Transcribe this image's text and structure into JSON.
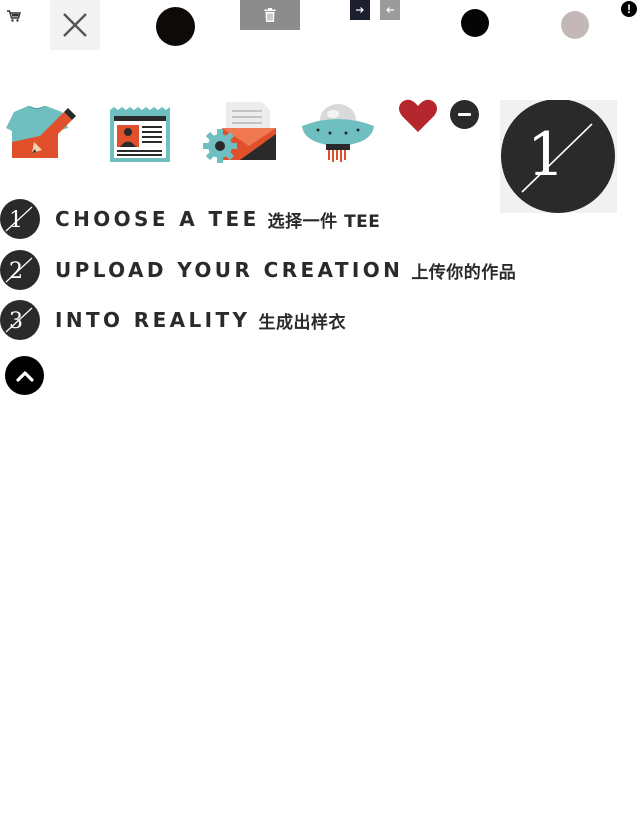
{
  "toolbar": {
    "icons": [
      "cart-icon",
      "close-icon",
      "trash-icon",
      "arrow-right-icon",
      "arrow-left-icon",
      "alert-icon"
    ],
    "alert_mark": "!",
    "dot_colors": [
      "#0e0a08",
      "#050505",
      "#c4b8b7"
    ]
  },
  "illustrations": [
    "tee-pencil",
    "newspaper-profile",
    "gear-envelope",
    "ufo"
  ],
  "colors": {
    "teal": "#6fbfc1",
    "orange": "#e0502a",
    "dark": "#2a2a2a",
    "heart": "#b5262d"
  },
  "steps": [
    {
      "number": "1",
      "title": "CHOOSE A TEE",
      "title_zh": "选择一件 TEE"
    },
    {
      "number": "2",
      "title": "UPLOAD YOUR CREATION",
      "title_zh": "上传你的作品"
    },
    {
      "number": "3",
      "title": "INTO REALITY",
      "title_zh": "生成出样衣"
    }
  ],
  "big_badge": {
    "number": "1"
  }
}
